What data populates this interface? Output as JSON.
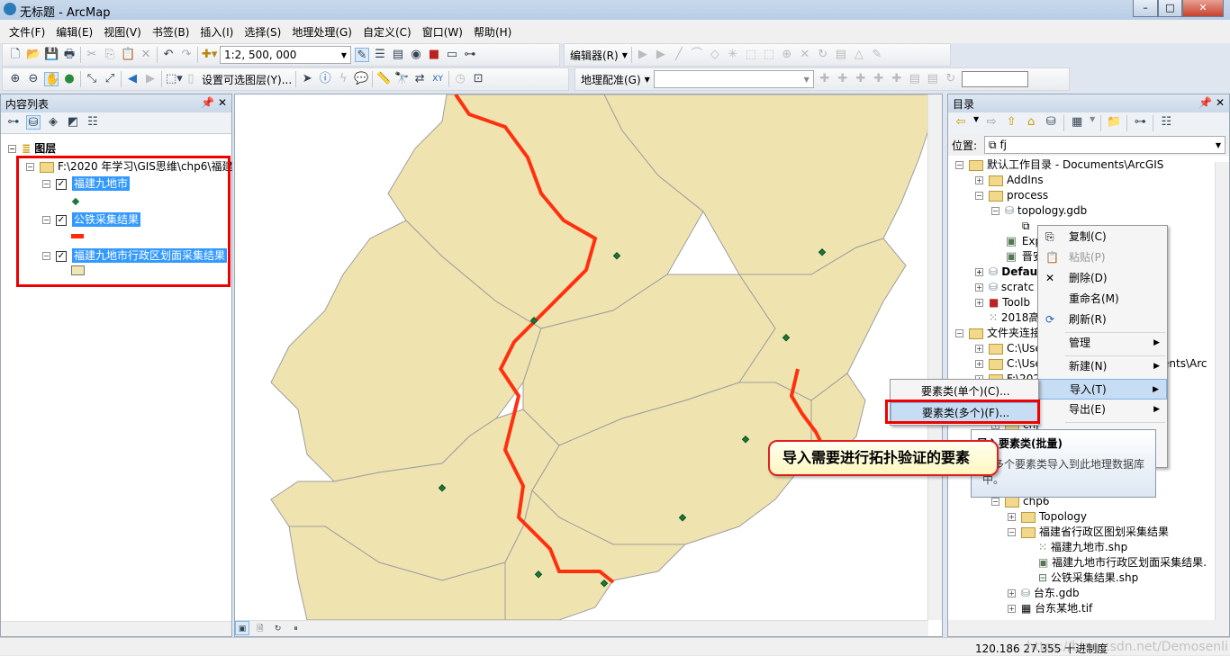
{
  "window": {
    "title": "无标题 - ArcMap"
  },
  "menu": [
    "文件(F)",
    "编辑(E)",
    "视图(V)",
    "书签(B)",
    "插入(I)",
    "选择(S)",
    "地理处理(G)",
    "自定义(C)",
    "窗口(W)",
    "帮助(H)"
  ],
  "toolbar": {
    "scale": "1:2, 500, 000",
    "editor": "编辑器(R)",
    "select_layers": "设置可选图层(Y)...",
    "georef": "地理配准(G)",
    "georef_layer": "",
    "georef_input": ""
  },
  "toc": {
    "title": "内容列表",
    "root": "图层",
    "folder": "F:\\2020 年学习\\GIS思维\\chp6\\福建",
    "layers": [
      {
        "name": "福建九地市",
        "symbol": "point",
        "color": "#1a7a3a",
        "checked": true
      },
      {
        "name": "公铁采集结果",
        "symbol": "line",
        "color": "#ff2a0a",
        "checked": true
      },
      {
        "name": "福建九地市行政区划面采集结果",
        "symbol": "polygon",
        "color": "#f0e6b4",
        "checked": true
      }
    ]
  },
  "map": {
    "land_color": "#efe4b0",
    "rail_color": "#ff3010",
    "city_color": "#1a7a3a"
  },
  "catalog": {
    "title": "目录",
    "location_label": "位置:",
    "location": "fj",
    "items": [
      "默认工作目录 - Documents\\ArcGIS",
      "AddIns",
      "process",
      "topology.gdb",
      "",
      "Exp",
      "晋安",
      "Defau",
      "scratc",
      "Toolb",
      "2018高",
      "文件夹连接",
      "C:\\Use",
      "C:\\Use",
      "F:\\202",
      "chp",
      "chp6",
      "Topology",
      "福建省行政区图划采集结果",
      "福建九地市.shp",
      "福建九地市行政区划面采集结果.",
      "公铁采集结果.shp",
      "台东.gdb",
      "台东某地.tif"
    ],
    "partial_right": [
      "p",
      "ents\\Arc"
    ]
  },
  "context_menu": [
    {
      "label": "复制(C)",
      "icon": "copy-icon"
    },
    {
      "label": "粘贴(P)",
      "icon": "paste-icon",
      "disabled": true
    },
    {
      "label": "删除(D)",
      "icon": "delete-icon"
    },
    {
      "label": "重命名(M)"
    },
    {
      "label": "刷新(R)",
      "icon": "refresh-icon"
    },
    {
      "label": "管理"
    },
    {
      "label": "新建(N)"
    },
    {
      "label": "导入(T)"
    },
    {
      "label": "导出(E)"
    }
  ],
  "submenu": [
    "要素类(单个)(C)...",
    "要素类(多个)(F)..."
  ],
  "tooltip": {
    "title": "导入要素类(批量)",
    "body": "将多个要素类导入到此地理数据库中。"
  },
  "callout": "导入需要进行拓扑验证的要素",
  "status": {
    "coords": "120.186  27.355 十进制度",
    "watermark": "https://blog.csdn.net/Demosenli"
  }
}
